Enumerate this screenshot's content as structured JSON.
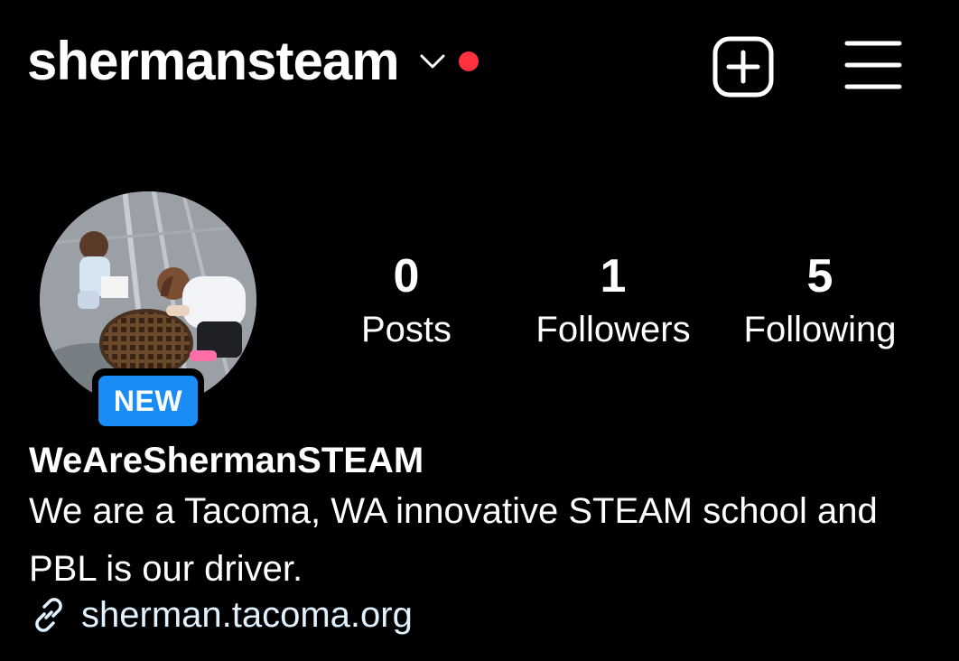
{
  "header": {
    "username": "shermansteam",
    "switch_icon": "chevron-down-icon",
    "notification_dot_color": "#ff3040",
    "create_icon": "plus-square-icon",
    "menu_icon": "hamburger-menu-icon"
  },
  "profile": {
    "avatar_icon": "profile-photo",
    "badge": "NEW",
    "badge_color": "#1a8cf5"
  },
  "stats": [
    {
      "count": "0",
      "label": "Posts"
    },
    {
      "count": "1",
      "label": "Followers"
    },
    {
      "count": "5",
      "label": "Following"
    }
  ],
  "bio": {
    "name": "WeAreShermanSTEAM",
    "text": "We are a Tacoma, WA innovative STEAM school and PBL is our driver.",
    "link_icon": "link-icon",
    "link": "sherman.tacoma.org"
  }
}
